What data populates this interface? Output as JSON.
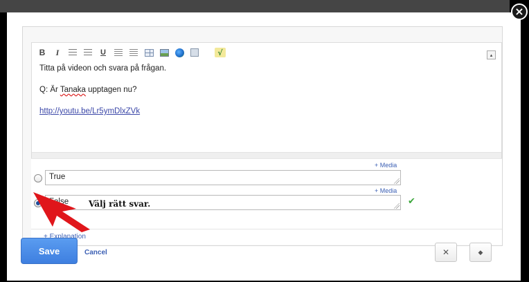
{
  "editor": {
    "toolbar": {
      "bold": "B",
      "italic": "I",
      "underline": "U",
      "math": "√"
    },
    "collapse": "▴",
    "lines": [
      "Titta på videon och svara på frågan."
    ],
    "question_prefix": "Q: Är ",
    "question_misspelled": "Tanaka",
    "question_suffix": " upptagen nu?",
    "link": "http://youtu.be/Lr5ymDlxZVk"
  },
  "answers": [
    {
      "media_label": "+ Media",
      "value": "True",
      "selected": false,
      "correct": false
    },
    {
      "media_label": "+ Media",
      "value": "False",
      "selected": true,
      "correct": true
    }
  ],
  "check_mark": "✔",
  "annotation": {
    "text": "Välj rätt svar."
  },
  "explanation_link": "+ Explanation",
  "actions": {
    "save_label": "Save",
    "cancel_label": "Cancel"
  },
  "icons": {
    "close": "×",
    "settings": "✕",
    "tag": "◆"
  },
  "colors": {
    "save_button": "#4a8ce8",
    "link": "#3b5fb4",
    "correct_check": "#3aa63a",
    "annotation_arrow": "#e0161b"
  }
}
